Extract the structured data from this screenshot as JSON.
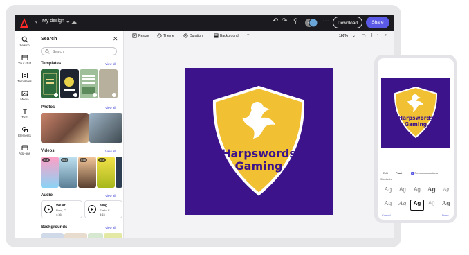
{
  "topbar": {
    "title": "My design ...",
    "download_label": "Download",
    "share_label": "Share",
    "back_icon": "chevron-left-icon",
    "more_icon": "more-icon"
  },
  "rail": {
    "items": [
      {
        "label": "Search",
        "icon": "search-icon"
      },
      {
        "label": "Your stuff",
        "icon": "folder-icon"
      },
      {
        "label": "Templates",
        "icon": "templates-icon"
      },
      {
        "label": "Media",
        "icon": "media-icon"
      },
      {
        "label": "Text",
        "icon": "text-icon"
      },
      {
        "label": "Elements",
        "icon": "elements-icon"
      },
      {
        "label": "Add-ons",
        "icon": "addons-icon"
      }
    ]
  },
  "panel": {
    "title": "Search",
    "search_placeholder": "Search",
    "view_all": "View all",
    "sections": {
      "templates": "Templates",
      "photos": "Photos",
      "videos": "Videos",
      "audio": "Audio",
      "backgrounds": "Backgrounds"
    },
    "video_durations": [
      "0:16",
      "0:16",
      "0:08",
      "0:15"
    ],
    "audio": [
      {
        "title": "We ar...",
        "artist": "Russ, C...",
        "time": "4:36"
      },
      {
        "title": "King ...",
        "artist": "Earth, C...",
        "time": "3:15"
      }
    ]
  },
  "toolbar": {
    "resize": "Resize",
    "theme": "Theme",
    "duration": "Duration",
    "background": "Background",
    "more": "•••",
    "zoom": "100%"
  },
  "design": {
    "line1": "Harpswords",
    "line2": "Gaming",
    "bg_color": "#3c138a",
    "shield_color": "#f2c033",
    "text_color": "#3c138a"
  },
  "phone": {
    "tabs": [
      "Edit",
      "Font",
      "Recommendations"
    ],
    "section_label": "Standards",
    "font_sample": "Ag",
    "cancel": "Cancel",
    "done": "Done"
  }
}
